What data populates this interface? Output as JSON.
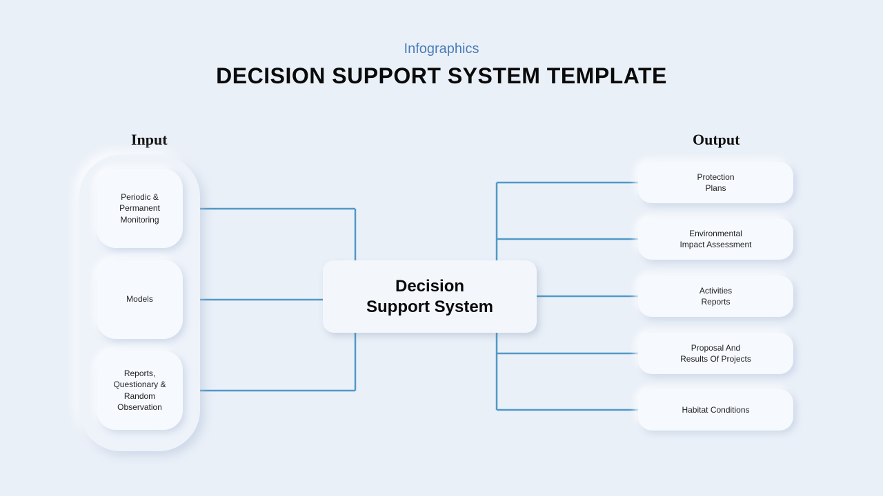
{
  "header": {
    "subtitle": "Infographics",
    "title": "DECISION SUPPORT SYSTEM TEMPLATE"
  },
  "labels": {
    "input": "Input",
    "output": "Output"
  },
  "center": {
    "label": "Decision\nSupport System"
  },
  "inputs": [
    {
      "label": "Periodic &\nPermanent\nMonitoring"
    },
    {
      "label": "Models"
    },
    {
      "label": "Reports,\nQuestionary &\nRandom\nObservation"
    }
  ],
  "outputs": [
    {
      "label": "Protection\nPlans"
    },
    {
      "label": "Environmental\nImpact Assessment"
    },
    {
      "label": "Activities\nReports"
    },
    {
      "label": "Proposal And\nResults Of Projects"
    },
    {
      "label": "Habitat Conditions"
    }
  ]
}
